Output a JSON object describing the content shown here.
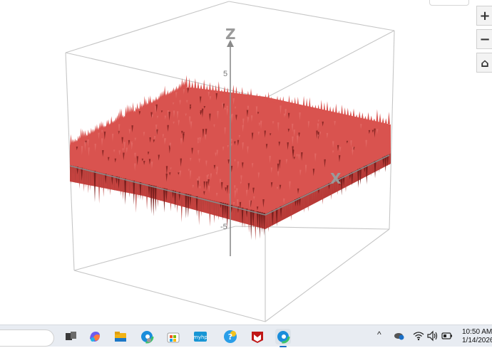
{
  "plot": {
    "axes": {
      "z": "Z",
      "x": "X"
    },
    "ticks": {
      "z_pos": "5",
      "z_neg": "-5"
    }
  },
  "controls": {
    "zoom_in": "+",
    "zoom_out": "−",
    "home": "⌂"
  },
  "colors": {
    "surface": "#d9534f",
    "surface_dark": "#7a1f1d"
  },
  "taskbar": {
    "apps": [
      "task-view",
      "copilot",
      "file-explorer",
      "edge",
      "microsoft-store",
      "hp-app",
      "help-app",
      "mcafee",
      "edge-active"
    ],
    "tray": {
      "chevron": "^",
      "wifi": "wifi",
      "volume": "volume",
      "battery": "battery"
    },
    "clock": {
      "time": "10:50 AM",
      "date": "1/14/2026"
    }
  }
}
